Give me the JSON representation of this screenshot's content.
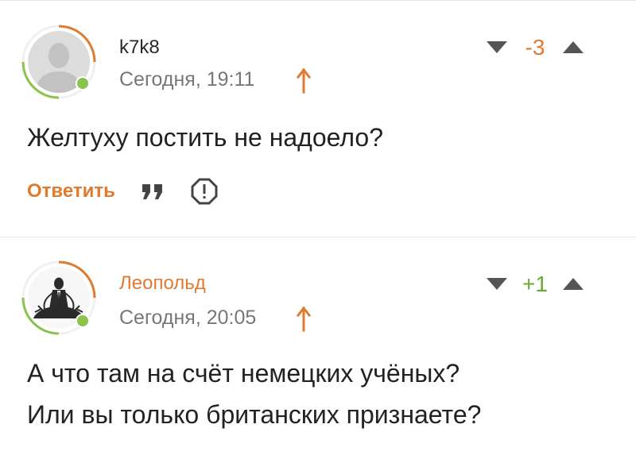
{
  "colors": {
    "accent": "#e07a2f",
    "positive": "#6aa832",
    "negative": "#e07a2f",
    "muted": "#777777",
    "online": "#8bc34a"
  },
  "comments": [
    {
      "username": "k7k8",
      "username_color": "#2a2a2a",
      "timestamp": "Сегодня, 19:11",
      "rating": "-3",
      "rating_color": "#e07a2f",
      "avatar_icon": "default-user-avatar-icon",
      "text_lines": [
        "Желтуху постить не надоело?"
      ],
      "reply_label": "Ответить"
    },
    {
      "username": "Леопольд",
      "username_color": "#e07a2f",
      "timestamp": "Сегодня, 20:05",
      "rating": "+1",
      "rating_color": "#6aa832",
      "avatar_icon": "meditating-man-avatar-icon",
      "text_lines": [
        "А что там на счёт немецких учёных?",
        "Или вы только британских признаете?"
      ]
    }
  ]
}
